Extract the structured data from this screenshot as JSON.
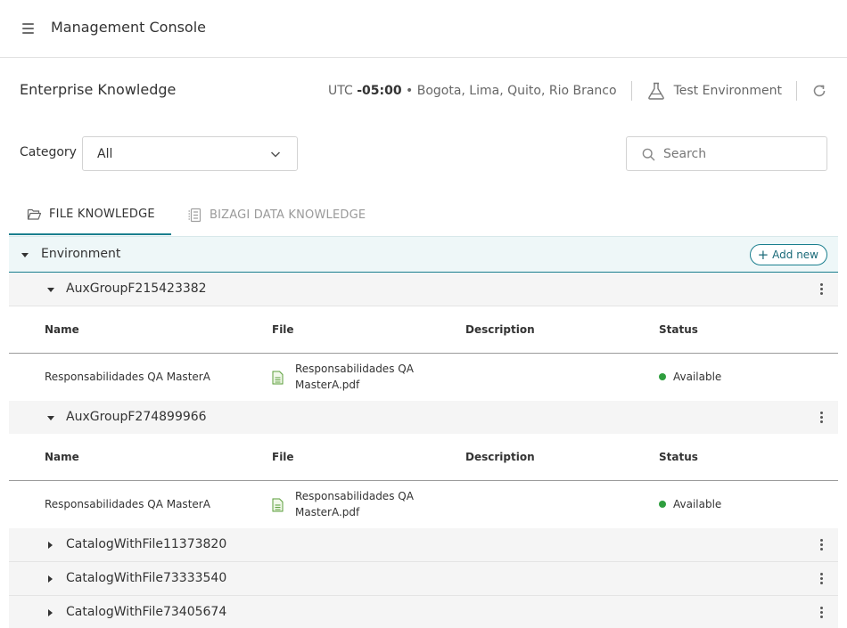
{
  "app": {
    "title": "Management Console"
  },
  "page": {
    "title": "Enterprise Knowledge"
  },
  "header": {
    "tz_prefix": "UTC ",
    "tz_offset": "-05:00",
    "tz_cities": " • Bogota, Lima, Quito, Rio Branco",
    "environment": "Test Environment"
  },
  "filters": {
    "category_label": "Category",
    "category_value": "All",
    "search_placeholder": "Search"
  },
  "tabs": [
    {
      "label": "FILE KNOWLEDGE",
      "active": true
    },
    {
      "label": "BIZAGI DATA KNOWLEDGE",
      "active": false
    }
  ],
  "tree": {
    "root_label": "Environment",
    "add_new_label": "Add new",
    "columns": {
      "name": "Name",
      "file": "File",
      "description": "Description",
      "status": "Status"
    },
    "groups": [
      {
        "name": "AuxGroupF215423382",
        "expanded": true,
        "rows": [
          {
            "name": "Responsabilidades QA MasterA",
            "file": "Responsabilidades QA MasterA.pdf",
            "description": "",
            "status": "Available"
          }
        ]
      },
      {
        "name": "AuxGroupF274899966",
        "expanded": true,
        "rows": [
          {
            "name": "Responsabilidades QA MasterA",
            "file": "Responsabilidades QA MasterA.pdf",
            "description": "",
            "status": "Available"
          }
        ]
      },
      {
        "name": "CatalogWithFile11373820",
        "expanded": false
      },
      {
        "name": "CatalogWithFile73333540",
        "expanded": false
      },
      {
        "name": "CatalogWithFile73405674",
        "expanded": false
      }
    ]
  },
  "colors": {
    "accent": "#1a7f8e",
    "available": "#2e9e3e",
    "group_bg": "#f5f5f5",
    "root_bg": "#eef7f8"
  }
}
